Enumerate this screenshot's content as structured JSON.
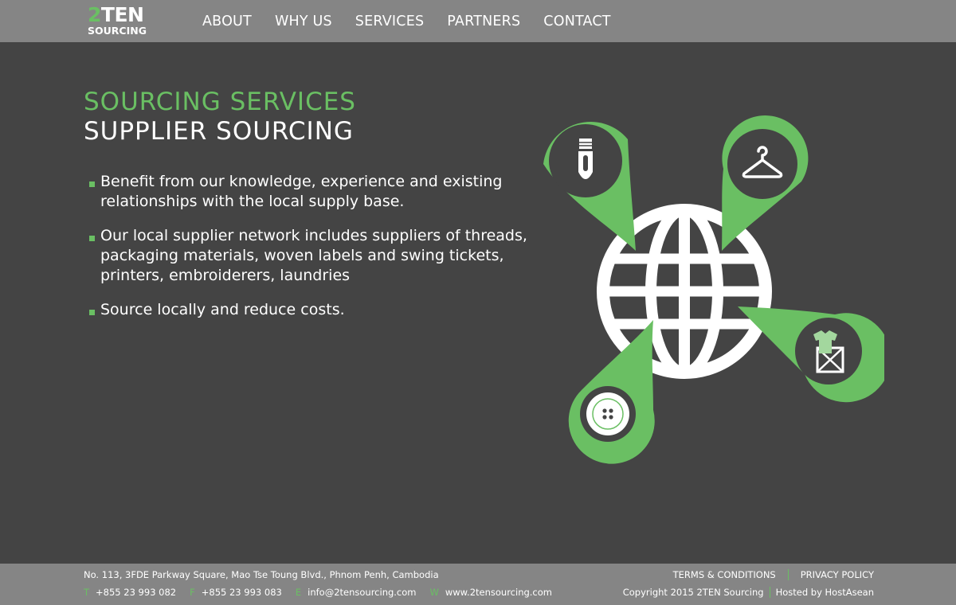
{
  "brand": {
    "logo_top_green": "2",
    "logo_top_white": "TEN",
    "logo_bottom": "SOURCING"
  },
  "nav": {
    "items": [
      "ABOUT",
      "WHY US",
      "SERVICES",
      "PARTNERS",
      "CONTACT"
    ]
  },
  "main": {
    "heading_green": "SOURCING SERVICES",
    "heading_white": "SUPPLIER SOURCING",
    "bullets": [
      "Benefit from our knowledge, experience and existing relationships with the local supply base.",
      "Our local supplier network includes suppliers of threads, packaging materials, woven labels and swing tickets, printers, embroiderers, laundries",
      "Source locally and reduce costs."
    ]
  },
  "illustration": {
    "icons": [
      "zipper-icon",
      "hanger-icon",
      "button-icon",
      "shirt-box-icon",
      "globe-icon"
    ]
  },
  "footer": {
    "address": "No. 113, 3FDE Parkway Square, Mao Tse Toung Blvd., Phnom Penh, Cambodia",
    "contacts": [
      {
        "key": "T",
        "value": "+855 23 993 082"
      },
      {
        "key": "F",
        "value": "+855 23 993 083"
      },
      {
        "key": "E",
        "value": "info@2tensourcing.com"
      },
      {
        "key": "W",
        "value": "www.2tensourcing.com"
      }
    ],
    "terms": "TERMS & CONDITIONS",
    "privacy": "PRIVACY POLICY",
    "copyright": "Copyright 2015 2TEN Sourcing",
    "hosted": "Hosted by HostAsean"
  },
  "colors": {
    "accent": "#6abf63",
    "background": "#444444",
    "bar": "#858585",
    "text": "#ffffff"
  }
}
